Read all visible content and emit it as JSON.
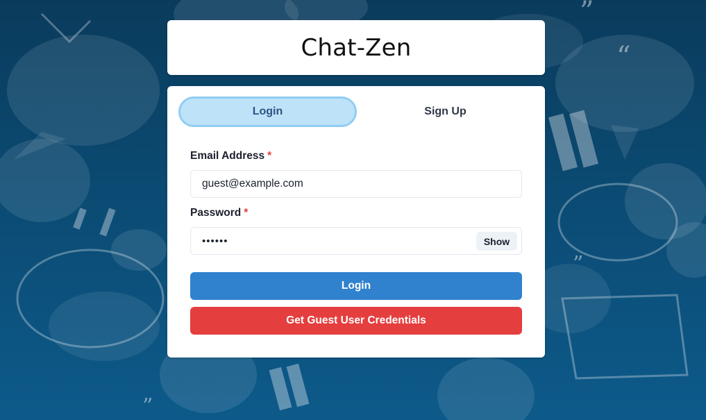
{
  "app": {
    "title": "Chat-Zen"
  },
  "tabs": [
    {
      "label": "Login",
      "active": true
    },
    {
      "label": "Sign Up",
      "active": false
    }
  ],
  "form": {
    "email": {
      "label": "Email Address",
      "required_mark": "*",
      "value": "guest@example.com"
    },
    "password": {
      "label": "Password",
      "required_mark": "*",
      "masked_value": "••••••",
      "toggle_label": "Show"
    },
    "login_button": "Login",
    "guest_button": "Get Guest User Credentials"
  },
  "colors": {
    "background": "#0b4a72",
    "active_tab_bg": "#bee3f8",
    "active_tab_border": "#90cdf4",
    "primary_button": "#3182ce",
    "danger_button": "#e53e3e",
    "required_mark": "#e53e3e"
  },
  "icons": {
    "background_pattern": "chat-bubble-icon"
  }
}
